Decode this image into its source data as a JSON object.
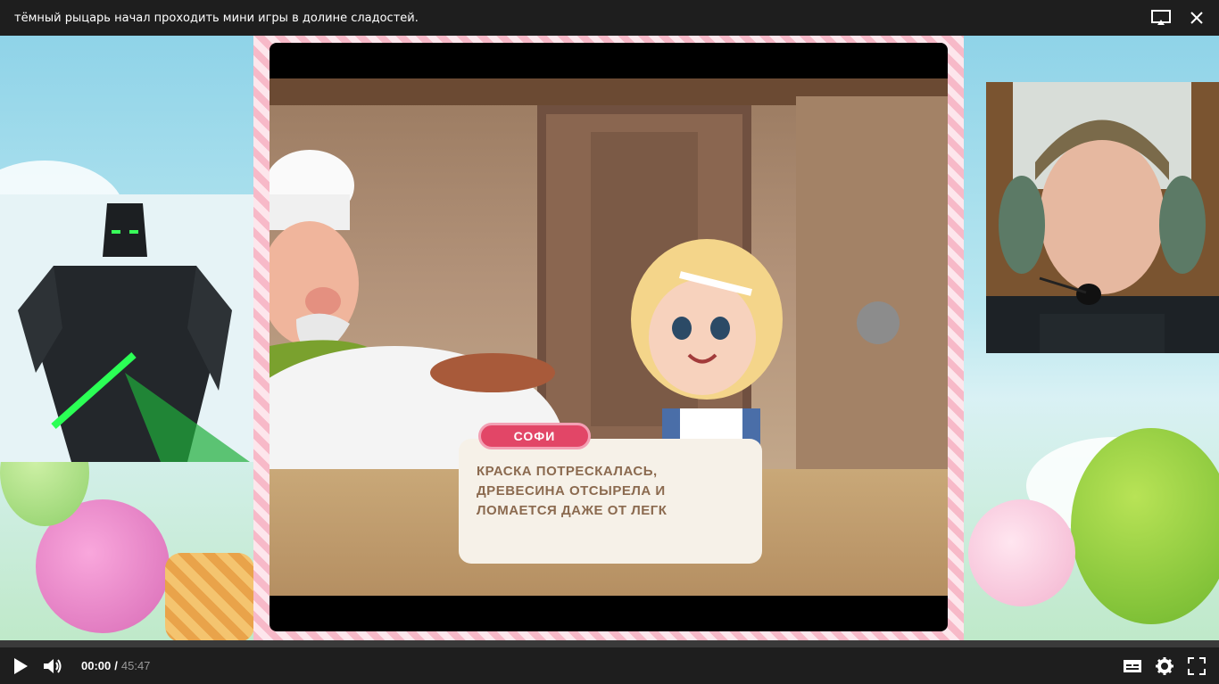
{
  "window": {
    "title": "тёмный рыцарь начал проходить мини игры в долине сладостей."
  },
  "game": {
    "speaker_name": "СОФИ",
    "dialog_text": "КРАСКА ПОТРЕСКАЛАСЬ, ДРЕВЕСИНА ОТСЫРЕЛА И ЛОМАЕТСЯ ДАЖЕ ОТ ЛЕГК"
  },
  "player": {
    "current_time": "00:00",
    "separator": "/",
    "total_time": "45:47",
    "progress": 0
  },
  "icons": {
    "cast": "cast-icon",
    "close": "close-icon",
    "play": "play-icon",
    "volume": "volume-icon",
    "subtitles": "subtitles-icon",
    "settings": "gear-icon",
    "fullscreen": "fullscreen-icon"
  },
  "colors": {
    "bar_bg": "#1e1e1e",
    "accent_pink": "#e24667",
    "progress": "#ff0000"
  }
}
